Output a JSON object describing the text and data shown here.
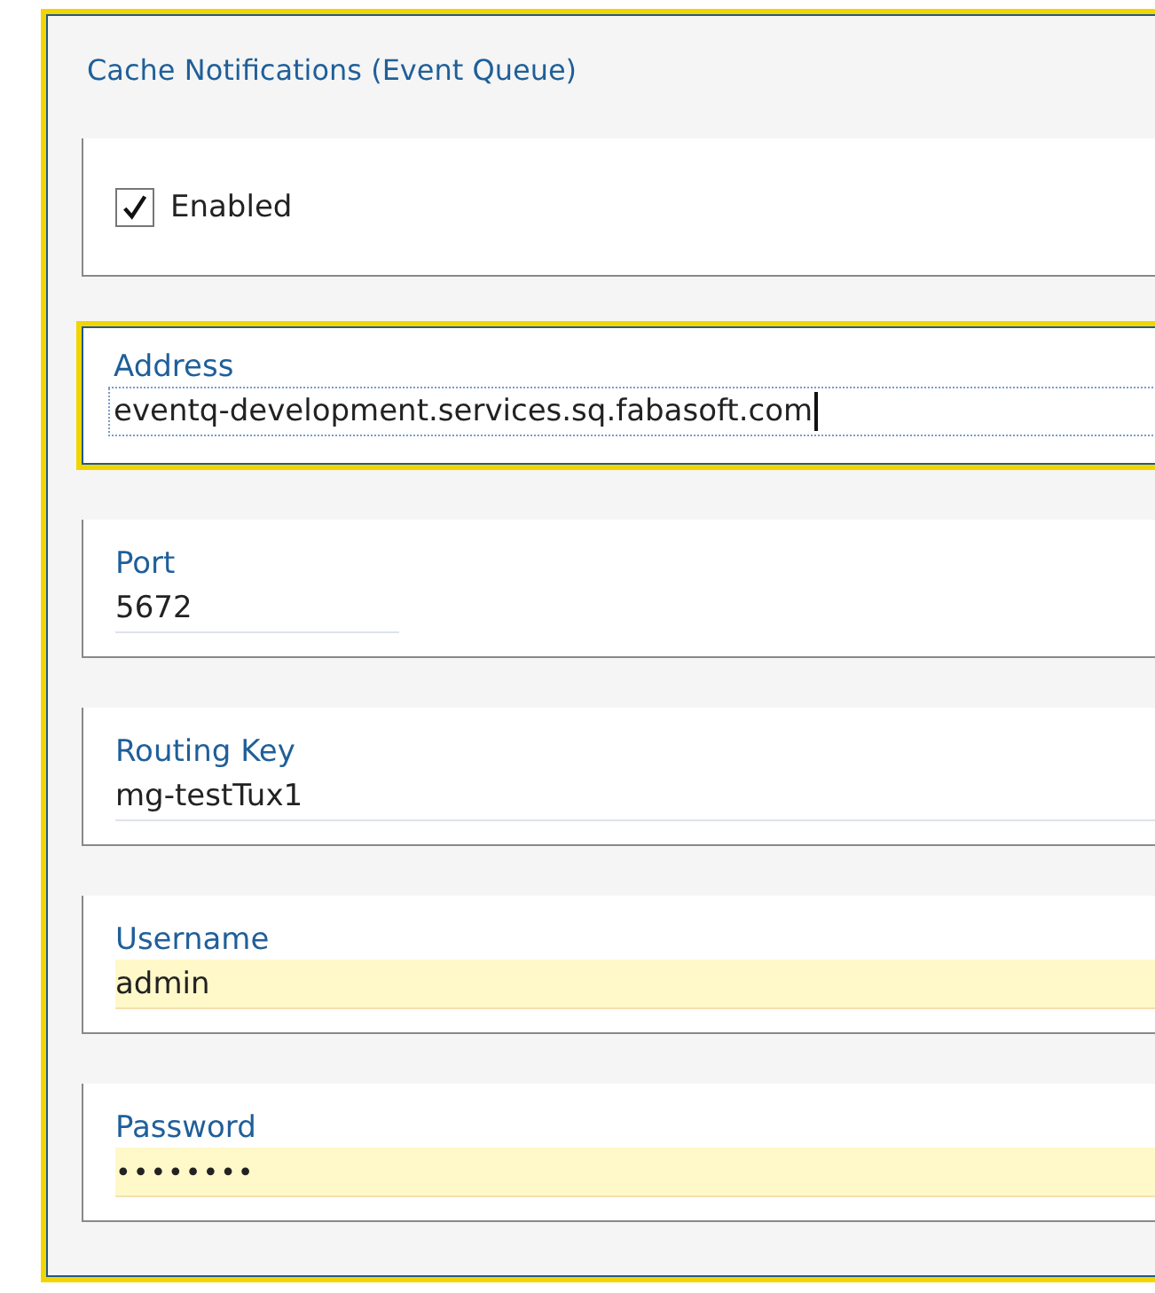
{
  "section": {
    "title": "Cache Notifications (Event Queue)",
    "focused": true
  },
  "fields": [
    {
      "kind": "checkbox",
      "label": "Enabled",
      "checked": true
    },
    {
      "kind": "text",
      "label": "Address",
      "value": "eventq-development.services.sq.fabasoft.com",
      "focused": true,
      "autofilled": false
    },
    {
      "kind": "number",
      "label": "Port",
      "value": "5672",
      "focused": false,
      "autofilled": false
    },
    {
      "kind": "text",
      "label": "Routing Key",
      "value": "mg-testTux1",
      "focused": false,
      "autofilled": false
    },
    {
      "kind": "text",
      "label": "Username",
      "value": "admin",
      "focused": false,
      "autofilled": true
    },
    {
      "kind": "password",
      "label": "Password",
      "value": "••••••••",
      "focused": false,
      "autofilled": true
    }
  ]
}
